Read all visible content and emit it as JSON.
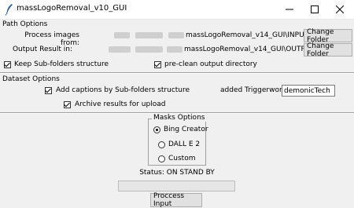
{
  "window": {
    "title": "massLogoRemoval_v10_GUI",
    "min_glyph": "—",
    "max_glyph": "☐",
    "close_glyph": "✕"
  },
  "path_options": {
    "section_label": "Path Options",
    "process_label": "Process images from:",
    "process_path": "massLogoRemoval_v14_GUI\\INPUT",
    "output_label": "Output Result in:",
    "output_path": "massLogoRemoval_v14_GUI\\OUTPUT",
    "change_folder_label": "Change Folder",
    "keep_subfolders": {
      "label": "Keep Sub-folders structure",
      "checked": true
    },
    "preclean": {
      "label": "pre-clean output directory",
      "checked": true
    }
  },
  "dataset_options": {
    "section_label": "Dataset Options",
    "captions": {
      "label": "Add captions by Sub-folders structure",
      "checked": true
    },
    "trigger_label": "added Triggerword:",
    "trigger_value": "demonicTech",
    "archive": {
      "label": "Archive results for upload",
      "checked": true
    }
  },
  "masks_options": {
    "group_label": "Masks Options",
    "options": [
      "Bing Creator",
      "DALL E 2",
      "Custom"
    ],
    "selected": "Bing Creator"
  },
  "status": {
    "label": "Status: ON STAND BY",
    "progress": 0
  },
  "process_button_label": "Proccess Input",
  "colors": {
    "progress_fill": "#06b025",
    "button_bg": "#e1e1e1"
  }
}
